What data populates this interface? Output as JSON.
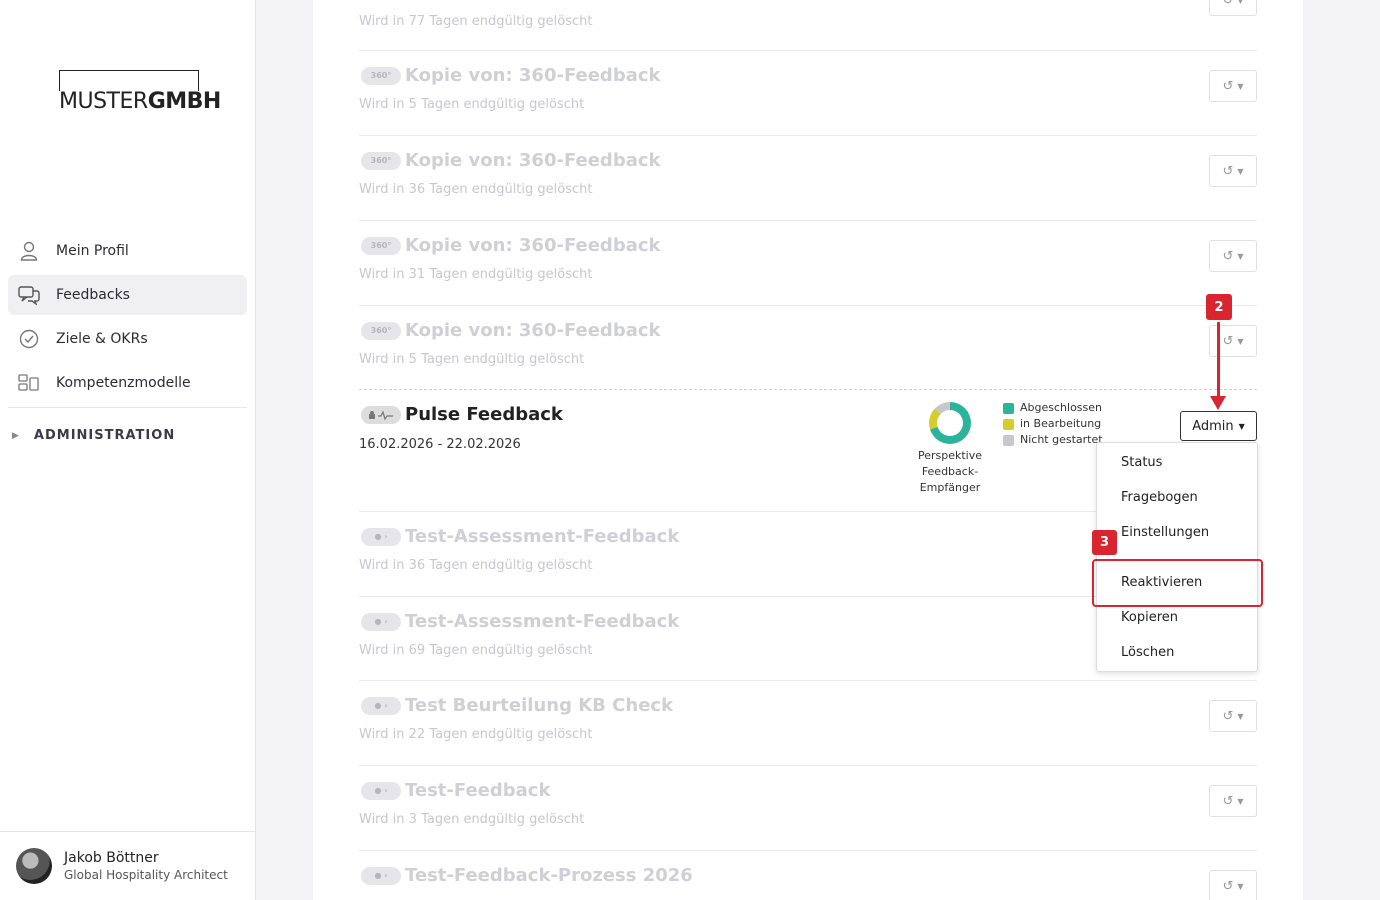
{
  "sidebar": {
    "logo": {
      "light": "MUSTER",
      "bold": "GMBH"
    },
    "items": [
      {
        "label": "Mein Profil",
        "icon": "user-icon"
      },
      {
        "label": "Feedbacks",
        "icon": "chat-icon"
      },
      {
        "label": "Ziele & OKRs",
        "icon": "check-circle-icon"
      },
      {
        "label": "Kompetenzmodelle",
        "icon": "grid-icon"
      }
    ],
    "admin_label": "ADMINISTRATION",
    "user": {
      "name": "Jakob Böttner",
      "role": "Global Hospitality Architect"
    }
  },
  "rows_top": [
    {
      "title": "",
      "sub": "Wird in 77 Tagen endgültig gelöscht",
      "pill": "360°"
    },
    {
      "title": "Kopie von: 360-Feedback",
      "sub": "Wird in 5 Tagen endgültig gelöscht",
      "pill": "360°"
    },
    {
      "title": "Kopie von: 360-Feedback",
      "sub": "Wird in 36 Tagen endgültig gelöscht",
      "pill": "360°"
    },
    {
      "title": "Kopie von: 360-Feedback",
      "sub": "Wird in 31 Tagen endgültig gelöscht",
      "pill": "360°"
    },
    {
      "title": "Kopie von: 360-Feedback",
      "sub": "Wird in 5 Tagen endgültig gelöscht",
      "pill": "360°"
    }
  ],
  "active": {
    "title": "Pulse Feedback",
    "date": "16.02.2026 - 22.02.2026",
    "donut_label": [
      "Perspektive",
      "Feedback-",
      "Empfänger"
    ],
    "progress": {
      "completed": 0.7,
      "in_progress": 0.17,
      "not_started": 0.13
    },
    "legend": [
      {
        "label": "Abgeschlossen",
        "color": "#2bb39b"
      },
      {
        "label": "in Bearbeitung",
        "color": "#d7cd2a"
      },
      {
        "label": "Nicht gestartet",
        "color": "#c8c8cc"
      }
    ],
    "admin_button": "Admin"
  },
  "menu": [
    "Status",
    "Fragebogen",
    "Einstellungen",
    "Reaktivieren",
    "Kopieren",
    "Löschen"
  ],
  "rows_bottom": [
    {
      "title": "Test-Assessment-Feedback",
      "sub": "Wird in 36 Tagen endgültig gelöscht"
    },
    {
      "title": "Test-Assessment-Feedback",
      "sub": "Wird in 69 Tagen endgültig gelöscht"
    },
    {
      "title": "Test Beurteilung KB Check",
      "sub": "Wird in 22 Tagen endgültig gelöscht"
    },
    {
      "title": "Test-Feedback",
      "sub": "Wird in 3 Tagen endgültig gelöscht"
    },
    {
      "title": "Test-Feedback-Prozess 2026",
      "sub": ""
    }
  ],
  "annotations": {
    "step_a": "2",
    "step_b": "3",
    "color": "#d9252f"
  }
}
